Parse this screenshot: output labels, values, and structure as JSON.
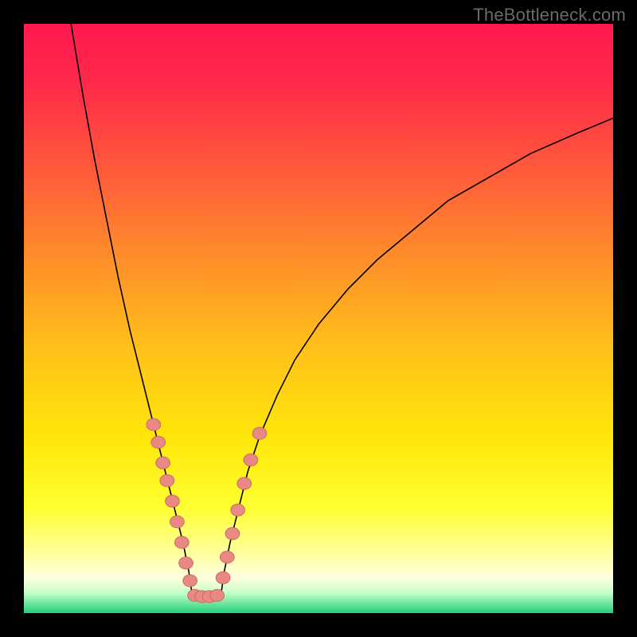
{
  "watermark": "TheBottleneck.com",
  "colors": {
    "frame": "#000000",
    "gradient_stops": [
      {
        "offset": 0.0,
        "color": "#ff1950"
      },
      {
        "offset": 0.1,
        "color": "#ff2a4a"
      },
      {
        "offset": 0.25,
        "color": "#ff5a3a"
      },
      {
        "offset": 0.4,
        "color": "#ff8f2a"
      },
      {
        "offset": 0.55,
        "color": "#ffc01a"
      },
      {
        "offset": 0.7,
        "color": "#ffe60a"
      },
      {
        "offset": 0.82,
        "color": "#ffff30"
      },
      {
        "offset": 0.9,
        "color": "#ffffa0"
      },
      {
        "offset": 0.94,
        "color": "#ffffe0"
      },
      {
        "offset": 0.965,
        "color": "#c8ffc8"
      },
      {
        "offset": 1.0,
        "color": "#21d07a"
      }
    ],
    "curve": "#000000",
    "marker_fill": "#e98983",
    "marker_stroke": "#cc6a63"
  },
  "chart_data": {
    "type": "line",
    "title": "",
    "xlabel": "",
    "ylabel": "",
    "xlim": [
      0,
      100
    ],
    "ylim": [
      0,
      100
    ],
    "note": "x and y are in percent of plot-area width/height; y=0 is top. Two branches forming a V.",
    "series": [
      {
        "name": "left-branch",
        "x": [
          8,
          10,
          12,
          14,
          16,
          18,
          20,
          21,
          22,
          23,
          24,
          25,
          26,
          27,
          28,
          28.5
        ],
        "y": [
          0,
          12,
          23,
          33,
          43,
          52,
          60,
          64,
          68,
          72,
          76,
          80,
          84,
          88,
          93,
          96.5
        ]
      },
      {
        "name": "right-branch",
        "x": [
          33.5,
          34,
          35,
          36.5,
          38,
          40,
          43,
          46,
          50,
          55,
          60,
          66,
          72,
          79,
          86,
          94,
          100
        ],
        "y": [
          96.5,
          93,
          88,
          82,
          76,
          70,
          63,
          57,
          51,
          45,
          40,
          35,
          30,
          26,
          22,
          18.5,
          16
        ]
      },
      {
        "name": "valley-floor",
        "x": [
          28.5,
          30,
          31.5,
          33.5
        ],
        "y": [
          96.5,
          97.2,
          97.2,
          96.5
        ]
      }
    ],
    "markers": {
      "name": "highlighted-points",
      "points": [
        {
          "x": 22.0,
          "y": 68.0
        },
        {
          "x": 22.8,
          "y": 71.0
        },
        {
          "x": 23.6,
          "y": 74.5
        },
        {
          "x": 24.3,
          "y": 77.5
        },
        {
          "x": 25.2,
          "y": 81.0
        },
        {
          "x": 26.0,
          "y": 84.5
        },
        {
          "x": 26.8,
          "y": 88.0
        },
        {
          "x": 27.5,
          "y": 91.5
        },
        {
          "x": 28.2,
          "y": 94.5
        },
        {
          "x": 29.0,
          "y": 97.0
        },
        {
          "x": 30.2,
          "y": 97.2
        },
        {
          "x": 31.5,
          "y": 97.2
        },
        {
          "x": 32.8,
          "y": 97.0
        },
        {
          "x": 33.8,
          "y": 94.0
        },
        {
          "x": 34.5,
          "y": 90.5
        },
        {
          "x": 35.4,
          "y": 86.5
        },
        {
          "x": 36.3,
          "y": 82.5
        },
        {
          "x": 37.4,
          "y": 78.0
        },
        {
          "x": 38.5,
          "y": 74.0
        },
        {
          "x": 40.0,
          "y": 69.5
        }
      ],
      "radius_pct": 1.2
    }
  }
}
